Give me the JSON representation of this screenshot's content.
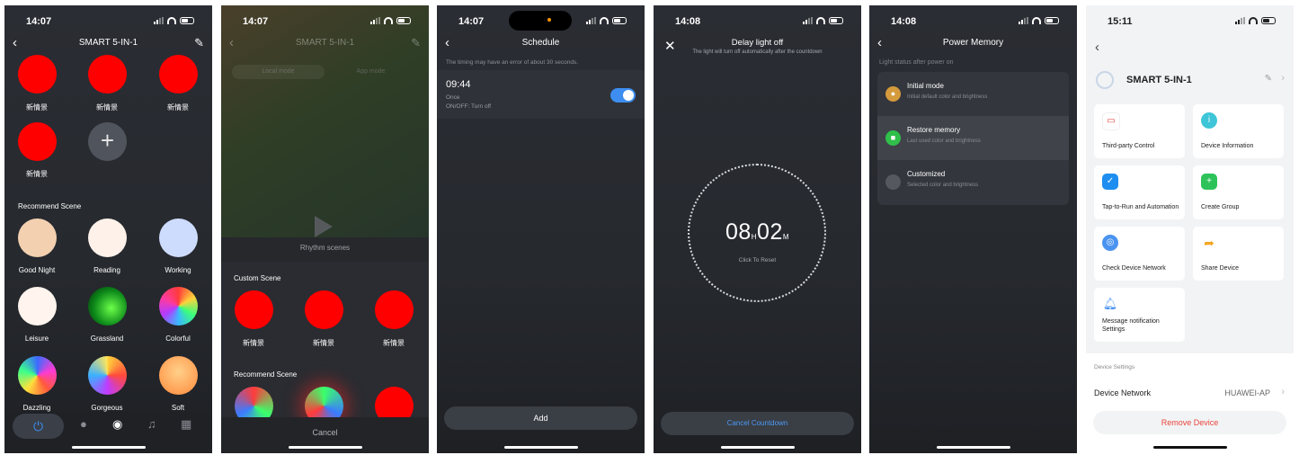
{
  "colors": {
    "accent": "#3d8ef0",
    "scene_red": "#ff0000",
    "danger": "#e8453c"
  },
  "screen1": {
    "time": "14:07",
    "title": "SMART 5-IN-1",
    "custom_scenes": [
      "新情景",
      "新情景",
      "新情景",
      "新情景"
    ],
    "add_icon": "plus-icon",
    "recommend_title": "Recommend Scene",
    "recommend": [
      "Good Night",
      "Reading",
      "Working",
      "Leisure",
      "Grassland",
      "Colorful",
      "Dazzling",
      "Gorgeous",
      "Soft"
    ],
    "tabs": [
      "power-icon",
      "bulb-icon",
      "palette-icon",
      "music-icon",
      "grid-icon"
    ]
  },
  "screen2": {
    "time": "14:07",
    "title": "SMART 5-IN-1",
    "mode_tabs": [
      "Local mode",
      "App mode"
    ],
    "rhythm": "Rhythm scenes",
    "custom_title": "Custom Scene",
    "custom_scenes": [
      "新情景",
      "新情景",
      "新情景"
    ],
    "recommend_title": "Recommend Scene",
    "cancel": "Cancel"
  },
  "screen3": {
    "time": "14:07",
    "title": "Schedule",
    "note": "The timing may have an error of about 30 seconds.",
    "item": {
      "time": "09:44",
      "repeat": "Once",
      "action": "ON/OFF: Turn off",
      "enabled": true
    },
    "add": "Add"
  },
  "screen4": {
    "time": "14:08",
    "title": "Delay light off",
    "subtitle": "The light will turn off automatically after the countdown",
    "hours": "08",
    "h_unit": "H",
    "minutes": "02",
    "m_unit": "M",
    "reset": "Click To Reset",
    "cancel": "Cancel Countdown"
  },
  "screen5": {
    "time": "14:08",
    "title": "Power Memory",
    "section": "Light status after power on",
    "options": [
      {
        "title": "Initial mode",
        "sub": "Initial default color and brightness"
      },
      {
        "title": "Restore memory",
        "sub": "Last used color and brightness"
      },
      {
        "title": "Customized",
        "sub": "Selected color and brightness"
      }
    ],
    "selected_index": 1
  },
  "screen6": {
    "time": "15:11",
    "device_name": "SMART 5-IN-1",
    "cards": [
      "Third-party Control",
      "Device Information",
      "Tap-to-Run and Automation",
      "Create Group",
      "Check Device Network",
      "Share Device",
      "Message notification Settings"
    ],
    "settings_section": "Device Settings",
    "network_label": "Device Network",
    "network_value": "HUAWEI-AP",
    "remove": "Remove Device"
  }
}
